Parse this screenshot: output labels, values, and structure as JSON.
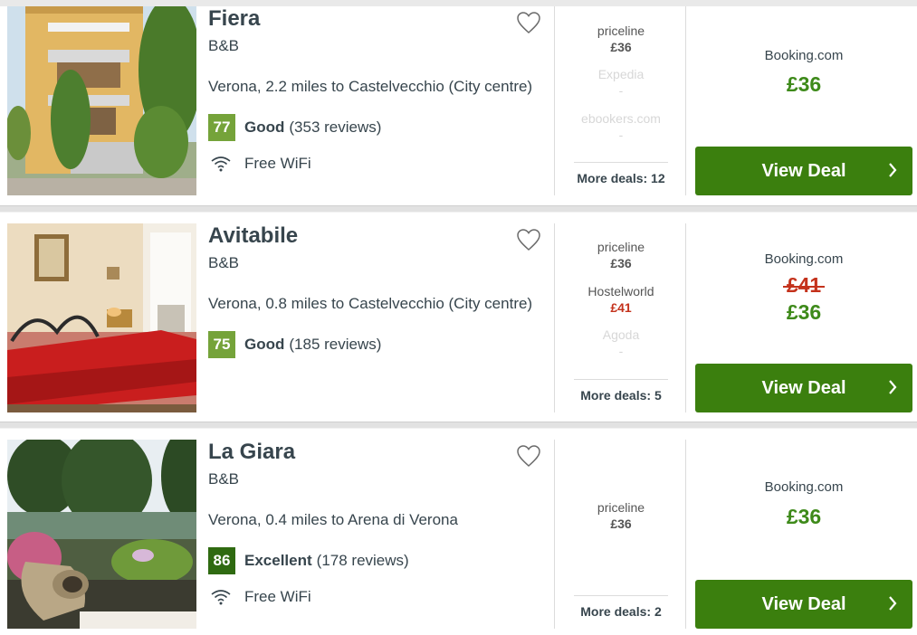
{
  "colors": {
    "score_good": "#75a33a",
    "score_excellent": "#2f6a11",
    "price_green": "#3e8a1a",
    "price_red": "#c4321c",
    "button_green": "#3b7f0e"
  },
  "hotels": [
    {
      "name": "Fiera",
      "type": "B&B",
      "location": "Verona, 2.2 miles to Castelvecchio (City centre)",
      "score": "77",
      "rating_word": "Good",
      "reviews": "(353 reviews)",
      "amenity": "Free WiFi",
      "deals": [
        {
          "site": "priceline",
          "price": "£36"
        },
        {
          "site": "Expedia",
          "price": "-"
        },
        {
          "site": "ebookers.com",
          "price": "-"
        }
      ],
      "more_deals": "More deals: 12",
      "best_site": "Booking.com",
      "best_price": "£36",
      "button": "View Deal"
    },
    {
      "name": "Avitabile",
      "type": "B&B",
      "location": "Verona, 0.8 miles to Castelvecchio (City centre)",
      "score": "75",
      "rating_word": "Good",
      "reviews": "(185 reviews)",
      "deals": [
        {
          "site": "priceline",
          "price": "£36"
        },
        {
          "site": "Hostelworld",
          "price": "£41"
        },
        {
          "site": "Agoda",
          "price": "-"
        }
      ],
      "more_deals": "More deals: 5",
      "best_site": "Booking.com",
      "best_old_price": "£41",
      "best_price": "£36",
      "button": "View Deal"
    },
    {
      "name": "La Giara",
      "type": "B&B",
      "location": "Verona, 0.4 miles to Arena di Verona",
      "score": "86",
      "rating_word": "Excellent",
      "reviews": "(178 reviews)",
      "amenity": "Free WiFi",
      "deals": [
        {
          "site": "priceline",
          "price": "£36"
        }
      ],
      "more_deals": "More deals: 2",
      "best_site": "Booking.com",
      "best_price": "£36",
      "button": "View Deal"
    }
  ]
}
